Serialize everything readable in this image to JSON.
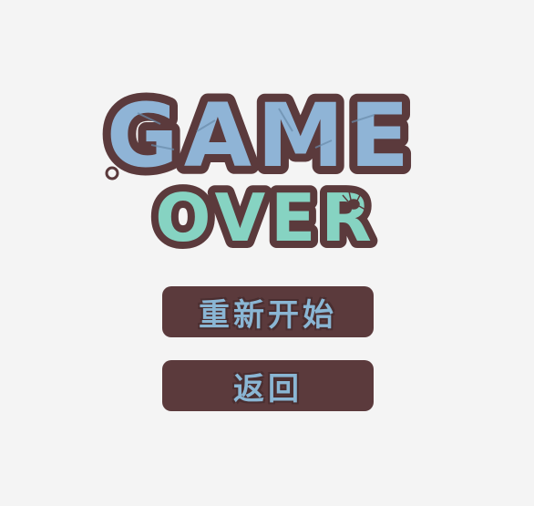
{
  "logo": {
    "line1": "GAME",
    "line2": "OVER",
    "colors": {
      "outline": "#5b3a3c",
      "game_fill": "#8fb4d6",
      "over_fill": "#86d3c2",
      "background": "#f4f4f4"
    }
  },
  "menu": {
    "restart_label": "重新开始",
    "back_label": "返回"
  },
  "colors": {
    "button_bg": "#5b3a3c",
    "button_text": "#8ab6d4"
  }
}
